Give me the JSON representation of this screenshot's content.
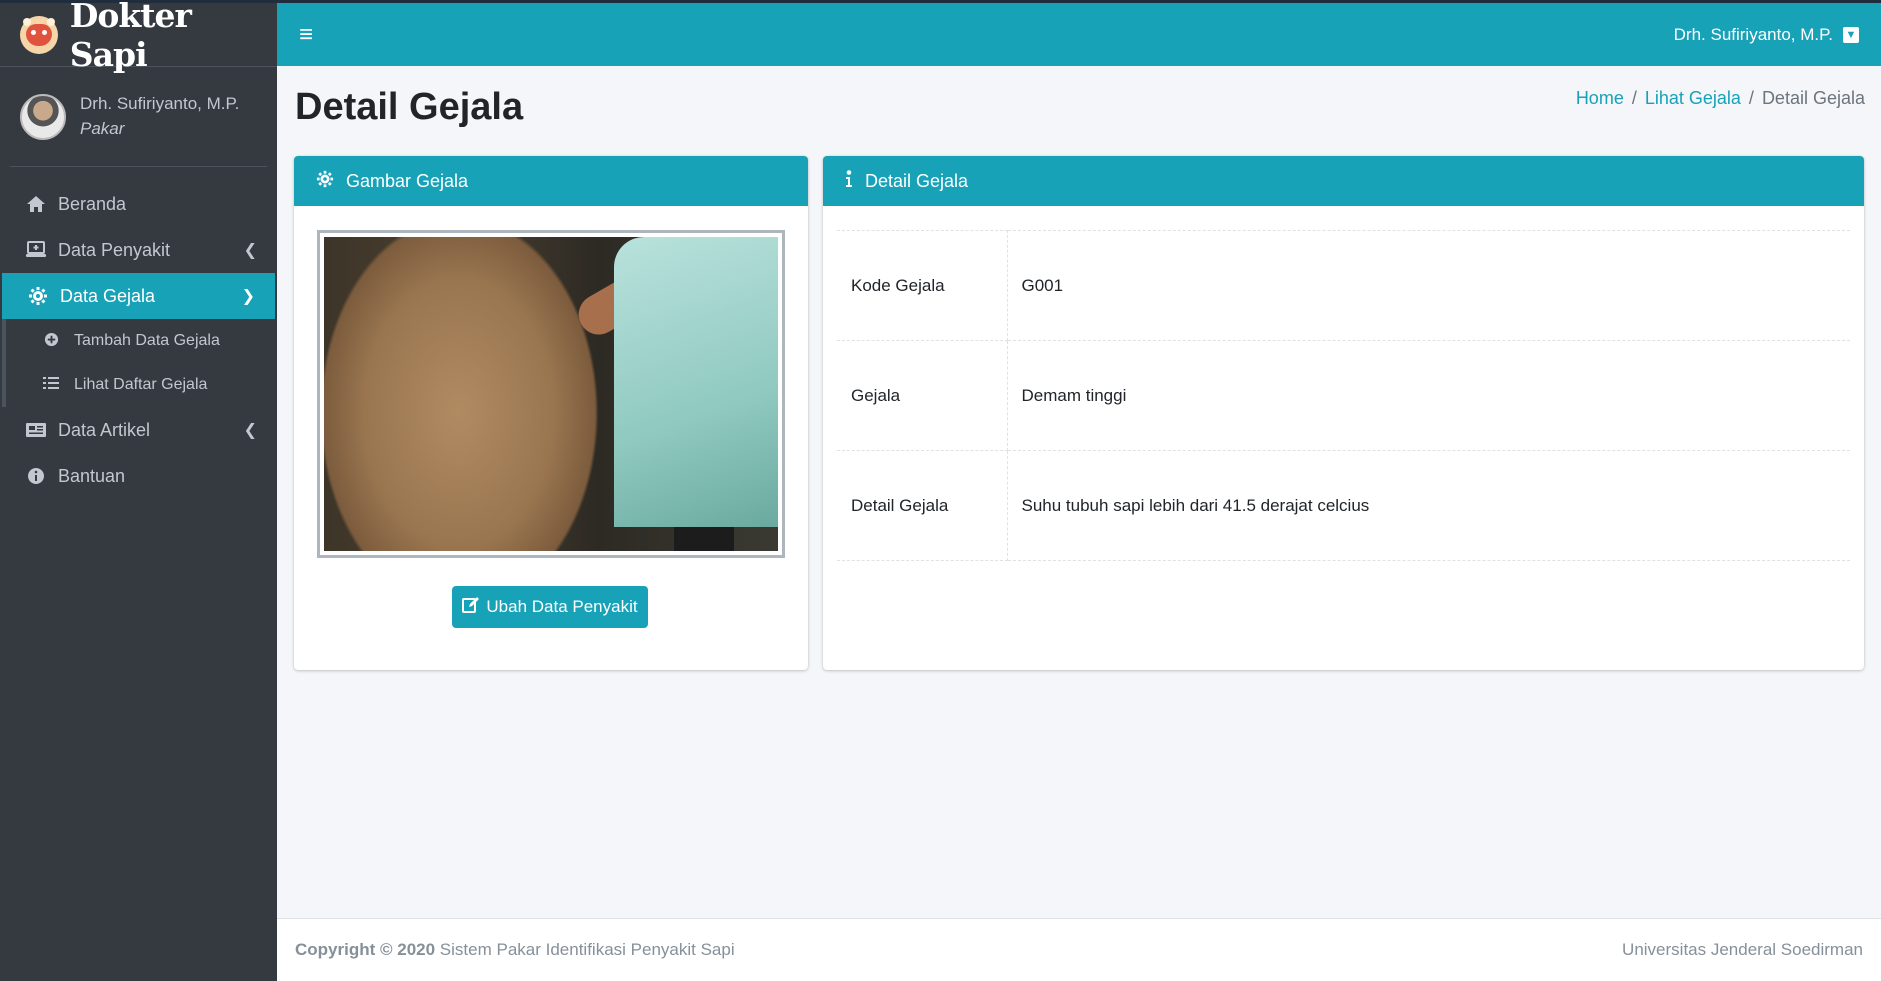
{
  "brand": {
    "name": "Dokter Sapi",
    "logo_icon": "cow-face-icon"
  },
  "user_panel": {
    "name": "Drh. Sufiriyanto, M.P.",
    "role": "Pakar"
  },
  "sidebar": {
    "items": [
      {
        "label": "Beranda",
        "icon": "home-icon"
      },
      {
        "label": "Data Penyakit",
        "icon": "laptop-medical-icon"
      },
      {
        "label": "Data Gejala",
        "icon": "gear-icon"
      },
      {
        "label": "Tambah Data Gejala",
        "icon": "plus-circle-icon"
      },
      {
        "label": "Lihat Daftar Gejala",
        "icon": "list-icon"
      },
      {
        "label": "Data Artikel",
        "icon": "newspaper-icon"
      },
      {
        "label": "Bantuan",
        "icon": "info-circle-icon"
      }
    ]
  },
  "header": {
    "user_label": "Drh. Sufiriyanto, M.P."
  },
  "page": {
    "title": "Detail Gejala"
  },
  "breadcrumb": {
    "home": "Home",
    "list": "Lihat Gejala",
    "current": "Detail Gejala"
  },
  "image_card": {
    "title": "Gambar Gejala",
    "edit_button": "Ubah Data Penyakit"
  },
  "detail_card": {
    "title": "Detail Gejala",
    "rows": [
      {
        "label": "Kode Gejala",
        "value": "G001"
      },
      {
        "label": "Gejala",
        "value": "Demam tinggi"
      },
      {
        "label": "Detail Gejala",
        "value": "Suhu tubuh sapi lebih dari 41.5 derajat celcius"
      }
    ]
  },
  "footer": {
    "copyright_bold": "Copyright © 2020",
    "copyright_text": "Sistem Pakar Identifikasi Penyakit Sapi",
    "right_text": "Universitas Jenderal Soedirman"
  },
  "colors": {
    "accent": "#17a2b8",
    "sidebar": "#343a40",
    "background": "#f4f6f9"
  }
}
